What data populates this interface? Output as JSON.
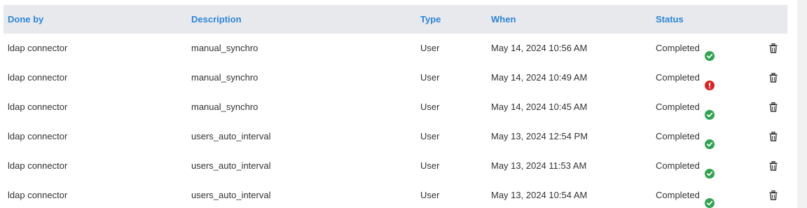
{
  "table": {
    "headers": {
      "done_by": "Done by",
      "description": "Description",
      "type": "Type",
      "when": "When",
      "status": "Status"
    },
    "rows": [
      {
        "done_by": "ldap connector",
        "description": "manual_synchro",
        "type": "User",
        "when": "May 14, 2024 10:56 AM",
        "status": "Completed",
        "status_icon": "check-circle-icon"
      },
      {
        "done_by": "ldap connector",
        "description": "manual_synchro",
        "type": "User",
        "when": "May 14, 2024 10:49 AM",
        "status": "Completed",
        "status_icon": "error-info-icon"
      },
      {
        "done_by": "ldap connector",
        "description": "manual_synchro",
        "type": "User",
        "when": "May 14, 2024 10:45 AM",
        "status": "Completed",
        "status_icon": "check-circle-icon"
      },
      {
        "done_by": "ldap connector",
        "description": "users_auto_interval",
        "type": "User",
        "when": "May 13, 2024 12:54 PM",
        "status": "Completed",
        "status_icon": "check-circle-icon"
      },
      {
        "done_by": "ldap connector",
        "description": "users_auto_interval",
        "type": "User",
        "when": "May 13, 2024 11:53 AM",
        "status": "Completed",
        "status_icon": "check-circle-icon"
      },
      {
        "done_by": "ldap connector",
        "description": "users_auto_interval",
        "type": "User",
        "when": "May 13, 2024 10:54 AM",
        "status": "Completed",
        "status_icon": "check-circle-icon"
      }
    ],
    "action_icon": "trash-icon"
  },
  "colors": {
    "header_text": "#2b86d9",
    "header_bg": "#e8e9ec",
    "success": "#2ea44f",
    "error": "#e02020"
  }
}
